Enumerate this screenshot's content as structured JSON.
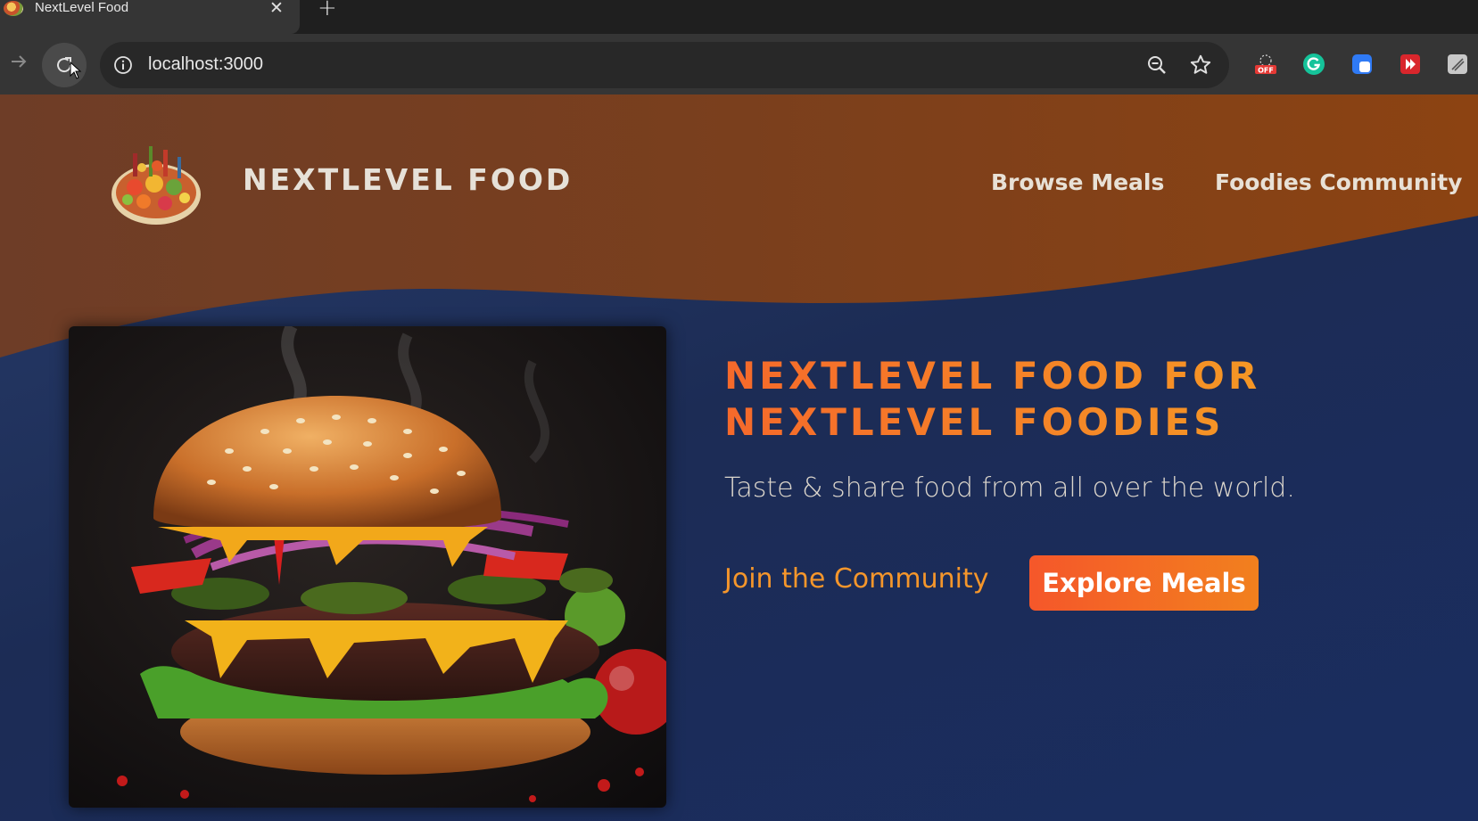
{
  "browser": {
    "tab_title": "NextLevel Food",
    "tab_close": "✕",
    "new_tab": "+",
    "url": "localhost:3000",
    "extensions": [
      "off-extension-icon",
      "grammarly-icon",
      "blue-extension-icon",
      "red-extension-icon",
      "gray-extension-icon"
    ]
  },
  "header": {
    "logo_text": "NEXTLEVEL FOOD",
    "nav": [
      {
        "label": "Browse Meals"
      },
      {
        "label": "Foodies Community"
      }
    ]
  },
  "hero": {
    "title_line1": "NEXTLEVEL FOOD FOR",
    "title_line2": "NEXTLEVEL FOODIES",
    "subtitle": "Taste & share food from all over the world.",
    "join_label": "Join the Community",
    "explore_label": "Explore Meals"
  },
  "colors": {
    "header_brown": "#7a3e1f",
    "page_navy": "#1c2c55",
    "accent_orange": "#f5692b",
    "accent_gold": "#f5a623"
  }
}
